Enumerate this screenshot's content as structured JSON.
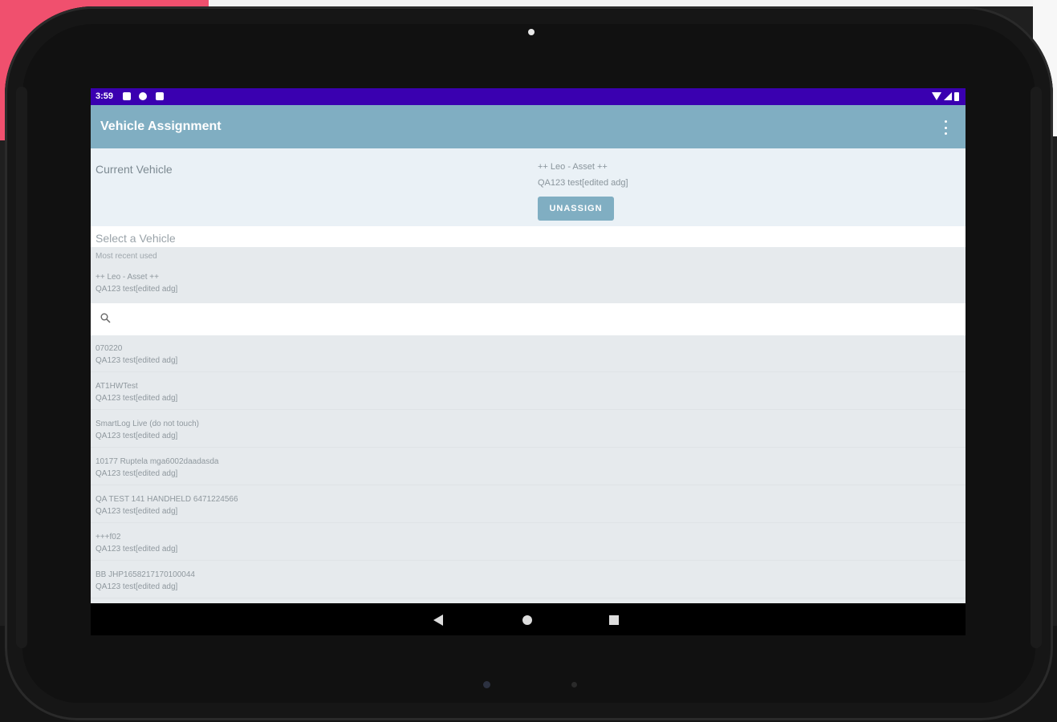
{
  "status_bar": {
    "time": "3:59"
  },
  "app_bar": {
    "title": "Vehicle Assignment"
  },
  "current_vehicle": {
    "label": "Current Vehicle",
    "name": "++ Leo - Asset ++",
    "group": "QA123 test[edited adg]",
    "unassign_label": "UNASSIGN"
  },
  "select": {
    "label": "Select a Vehicle",
    "recent_label": "Most recent used",
    "recent": {
      "name": "++ Leo - Asset ++",
      "group": "QA123 test[edited adg]"
    }
  },
  "search": {
    "placeholder": ""
  },
  "vehicles": [
    {
      "name": "070220",
      "group": "QA123 test[edited adg]"
    },
    {
      "name": "AT1HWTest",
      "group": "QA123 test[edited adg]"
    },
    {
      "name": "SmartLog Live (do not touch)",
      "group": "QA123 test[edited adg]"
    },
    {
      "name": "10177 Ruptela mga6002daadasda",
      "group": "QA123 test[edited adg]"
    },
    {
      "name": "QA TEST 141 HANDHELD 6471224566",
      "group": "QA123 test[edited adg]"
    },
    {
      "name": "+++f02",
      "group": "QA123 test[edited adg]"
    },
    {
      "name": "BB JHP1658217170100044",
      "group": "QA123 test[edited adg]"
    }
  ],
  "colors": {
    "status_bar": "#3a00b0",
    "app_bar": "#80aec2",
    "accent_button": "#80aec2"
  },
  "icons": {
    "search": "search-icon",
    "back": "back-icon",
    "home": "home-icon",
    "recents": "recents-icon",
    "overflow": "more-vert-icon"
  }
}
